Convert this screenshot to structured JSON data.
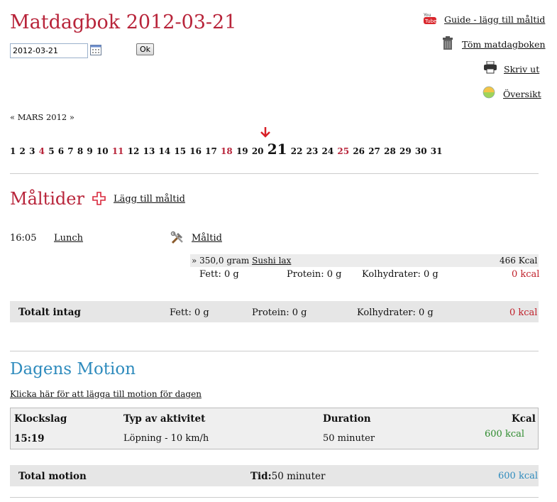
{
  "header": {
    "title": "Matdagbok 2012-03-21",
    "date_value": "2012-03-21",
    "ok_label": "Ok"
  },
  "toplinks": [
    {
      "icon": "youtube-icon",
      "label": "Guide - lägg till måltid"
    },
    {
      "icon": "trash-icon",
      "label": "Töm matdagboken"
    },
    {
      "icon": "printer-icon",
      "label": "Skriv ut"
    },
    {
      "icon": "overview-globe-icon",
      "label": "Översikt"
    }
  ],
  "calendar": {
    "month_nav": "« MARS 2012 »",
    "selected_day": "21",
    "days": [
      "1",
      "2",
      "3",
      "4",
      "5",
      "6",
      "7",
      "8",
      "9",
      "10",
      "11",
      "12",
      "13",
      "14",
      "15",
      "16",
      "17",
      "18",
      "19",
      "20",
      "21",
      "22",
      "23",
      "24",
      "25",
      "26",
      "27",
      "28",
      "29",
      "30",
      "31"
    ],
    "highlighted_days": [
      "4",
      "11",
      "18",
      "25"
    ]
  },
  "meals": {
    "heading": "Måltider",
    "add_label": "Lägg till måltid",
    "entries": [
      {
        "time": "16:05",
        "name": "Lunch",
        "tool_label": "Måltid",
        "item_prefix": "» 350,0 gram ",
        "item_link": "Sushi lax",
        "item_kcal": "466 Kcal",
        "fat": "Fett: 0 g",
        "protein": "Protein: 0 g",
        "carbs": "Kolhydrater: 0 g",
        "kcal": "0 kcal"
      }
    ],
    "total": {
      "label": "Totalt intag",
      "fat": "Fett: 0 g",
      "protein": "Protein: 0 g",
      "carbs": "Kolhydrater: 0 g",
      "kcal": "0 kcal"
    }
  },
  "exercise": {
    "heading": "Dagens Motion",
    "add_link": "Klicka här för att lägga till motion för dagen",
    "columns": [
      "Klockslag",
      "Typ av aktivitet",
      "Duration",
      "Kcal"
    ],
    "rows": [
      {
        "time": "15:19",
        "activity": "Löpning - 10 km/h",
        "duration": "50 minuter",
        "kcal": "600 kcal"
      }
    ],
    "total": {
      "label": "Total motion",
      "time_label": "Tid:",
      "time_value": "50 minuter",
      "kcal": "600 kcal"
    }
  },
  "colors": {
    "title_red": "#b8243a",
    "motion_blue": "#2e8bbd",
    "kcal_green": "#2e8b2e"
  }
}
